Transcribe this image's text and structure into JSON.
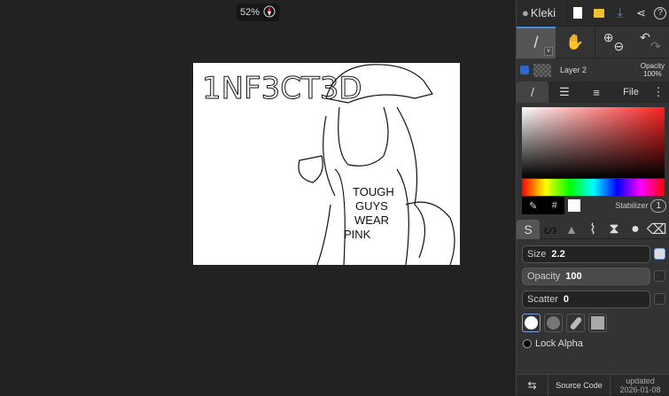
{
  "zoom": {
    "level": "52%"
  },
  "canvas": {
    "title_text": "1NF3CT3D",
    "shirt_text": [
      "TOUGH",
      "GUYS",
      "WEAR",
      "PINK"
    ]
  },
  "header": {
    "app_name": "Kleki"
  },
  "layer": {
    "name": "Layer 2",
    "opacity_label": "Opacity",
    "opacity_value": "100%"
  },
  "tabs": {
    "file": "File"
  },
  "color": {
    "hash": "#",
    "stabilizer_label": "Stabilizer",
    "stabilizer_value": "1",
    "current": "#ffffff"
  },
  "brush": {
    "size_label": "Size",
    "size_value": "2.2",
    "opacity_label": "Opacity",
    "opacity_value": "100",
    "scatter_label": "Scatter",
    "scatter_value": "0",
    "lock_alpha": "Lock Alpha"
  },
  "footer": {
    "source_code": "Source Code",
    "updated": "updated",
    "date": "2026-01-08"
  }
}
